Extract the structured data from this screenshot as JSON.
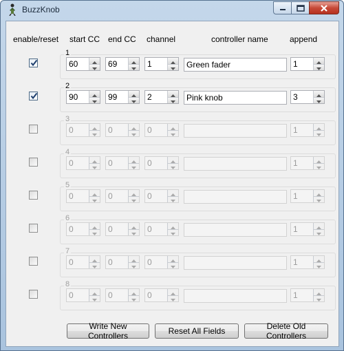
{
  "window": {
    "title": "BuzzKnob"
  },
  "headers": {
    "enable": "enable/reset",
    "start": "start CC",
    "end": "end CC",
    "channel": "channel",
    "name": "controller name",
    "append": "append"
  },
  "rows": [
    {
      "label": "1",
      "enabled": true,
      "start": "60",
      "end": "69",
      "channel": "1",
      "name": "Green fader",
      "append": "1"
    },
    {
      "label": "2",
      "enabled": true,
      "start": "90",
      "end": "99",
      "channel": "2",
      "name": "Pink knob",
      "append": "3"
    },
    {
      "label": "3",
      "enabled": false,
      "start": "0",
      "end": "0",
      "channel": "0",
      "name": "",
      "append": "1"
    },
    {
      "label": "4",
      "enabled": false,
      "start": "0",
      "end": "0",
      "channel": "0",
      "name": "",
      "append": "1"
    },
    {
      "label": "5",
      "enabled": false,
      "start": "0",
      "end": "0",
      "channel": "0",
      "name": "",
      "append": "1"
    },
    {
      "label": "6",
      "enabled": false,
      "start": "0",
      "end": "0",
      "channel": "0",
      "name": "",
      "append": "1"
    },
    {
      "label": "7",
      "enabled": false,
      "start": "0",
      "end": "0",
      "channel": "0",
      "name": "",
      "append": "1"
    },
    {
      "label": "8",
      "enabled": false,
      "start": "0",
      "end": "0",
      "channel": "0",
      "name": "",
      "append": "1"
    }
  ],
  "buttons": {
    "write": "Write New Controllers",
    "reset": "Reset All Fields",
    "delete": "Delete Old Controllers"
  }
}
